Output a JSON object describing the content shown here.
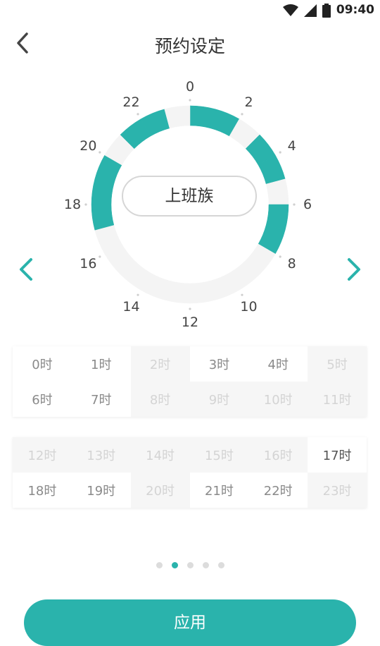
{
  "status_bar": {
    "time": "09:40",
    "icons": [
      "wifi-icon",
      "signal-icon",
      "battery-icon"
    ]
  },
  "header": {
    "title": "预约设定",
    "back_icon": "chevron-left-icon"
  },
  "dial": {
    "labels": [
      "0",
      "2",
      "4",
      "6",
      "8",
      "10",
      "12",
      "14",
      "16",
      "18",
      "20",
      "22"
    ],
    "mode_label": "上班族",
    "active_hours": [
      0,
      1,
      3,
      4,
      6,
      7,
      17,
      18,
      19,
      21,
      22
    ],
    "accent_color": "#2ab3ac",
    "inactive_color": "#f4f4f4",
    "prev_icon": "chevron-left-icon",
    "next_icon": "chevron-right-icon"
  },
  "grid_am": [
    {
      "label": "0时",
      "state": "on"
    },
    {
      "label": "1时",
      "state": "on"
    },
    {
      "label": "2时",
      "state": "off"
    },
    {
      "label": "3时",
      "state": "on"
    },
    {
      "label": "4时",
      "state": "on"
    },
    {
      "label": "5时",
      "state": "off"
    },
    {
      "label": "6时",
      "state": "on"
    },
    {
      "label": "7时",
      "state": "on"
    },
    {
      "label": "8时",
      "state": "off"
    },
    {
      "label": "9时",
      "state": "off"
    },
    {
      "label": "10时",
      "state": "off"
    },
    {
      "label": "11时",
      "state": "off"
    }
  ],
  "grid_pm": [
    {
      "label": "12时",
      "state": "off"
    },
    {
      "label": "13时",
      "state": "off"
    },
    {
      "label": "14时",
      "state": "off"
    },
    {
      "label": "15时",
      "state": "off"
    },
    {
      "label": "16时",
      "state": "off"
    },
    {
      "label": "17时",
      "state": "sel"
    },
    {
      "label": "18时",
      "state": "on"
    },
    {
      "label": "19时",
      "state": "on"
    },
    {
      "label": "20时",
      "state": "off"
    },
    {
      "label": "21时",
      "state": "on"
    },
    {
      "label": "22时",
      "state": "on"
    },
    {
      "label": "23时",
      "state": "off"
    }
  ],
  "pager": {
    "count": 5,
    "active_index": 1
  },
  "apply_button": {
    "label": "应用"
  }
}
